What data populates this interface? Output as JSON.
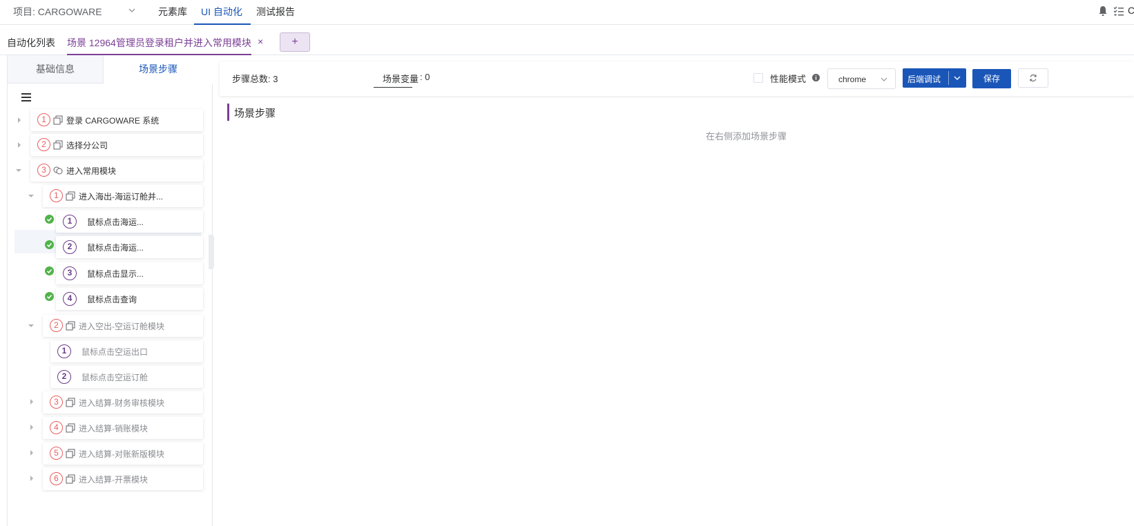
{
  "topbar": {
    "project": "项目: CARGOWARE",
    "nav": [
      "元素库",
      "UI 自动化",
      "测试报告"
    ],
    "cut_text": "C"
  },
  "tabs": {
    "list_label": "自动化列表",
    "scene_label": "场景 12964管理员登录租户并进入常用模块",
    "close": "×",
    "add": "+"
  },
  "left": {
    "tab_basic": "基础信息",
    "tab_steps": "场景步骤",
    "tree": [
      {
        "num": "1",
        "label": "登录 CARGOWARE 系统"
      },
      {
        "num": "2",
        "label": "选择分公司"
      },
      {
        "num": "3",
        "label": "进入常用模块"
      },
      {
        "num": "1",
        "label": "进入海出-海运订舱并..."
      },
      {
        "num": "1",
        "label": "鼠标点击海运..."
      },
      {
        "num": "2",
        "label": "鼠标点击海运..."
      },
      {
        "num": "3",
        "label": "鼠标点击显示..."
      },
      {
        "num": "4",
        "label": "鼠标点击查询"
      },
      {
        "num": "2",
        "label": "进入空出-空运订舱模块"
      },
      {
        "num": "1",
        "label": "鼠标点击空运出口"
      },
      {
        "num": "2",
        "label": "鼠标点击空运订舱"
      },
      {
        "num": "3",
        "label": "进入结算-财务审核模块"
      },
      {
        "num": "4",
        "label": "进入结算-销账模块"
      },
      {
        "num": "5",
        "label": "进入结算-对账新版模块"
      },
      {
        "num": "6",
        "label": "进入结算-开票模块"
      }
    ]
  },
  "toolbar": {
    "steps_total": "步骤总数: 3",
    "scene_var_label": "场景变量",
    "scene_var_value": ": 0",
    "perf_mode": "性能模式",
    "browser": "chrome",
    "debug_btn": "后端调试",
    "save_btn": "保存"
  },
  "main": {
    "section_title": "场景步骤",
    "empty_hint": "在右侧添加场景步骤"
  },
  "colors": {
    "primary": "#1a56b8",
    "purple": "#7b3f96",
    "red_badge": "#e95d5d",
    "success": "#52b34a"
  }
}
